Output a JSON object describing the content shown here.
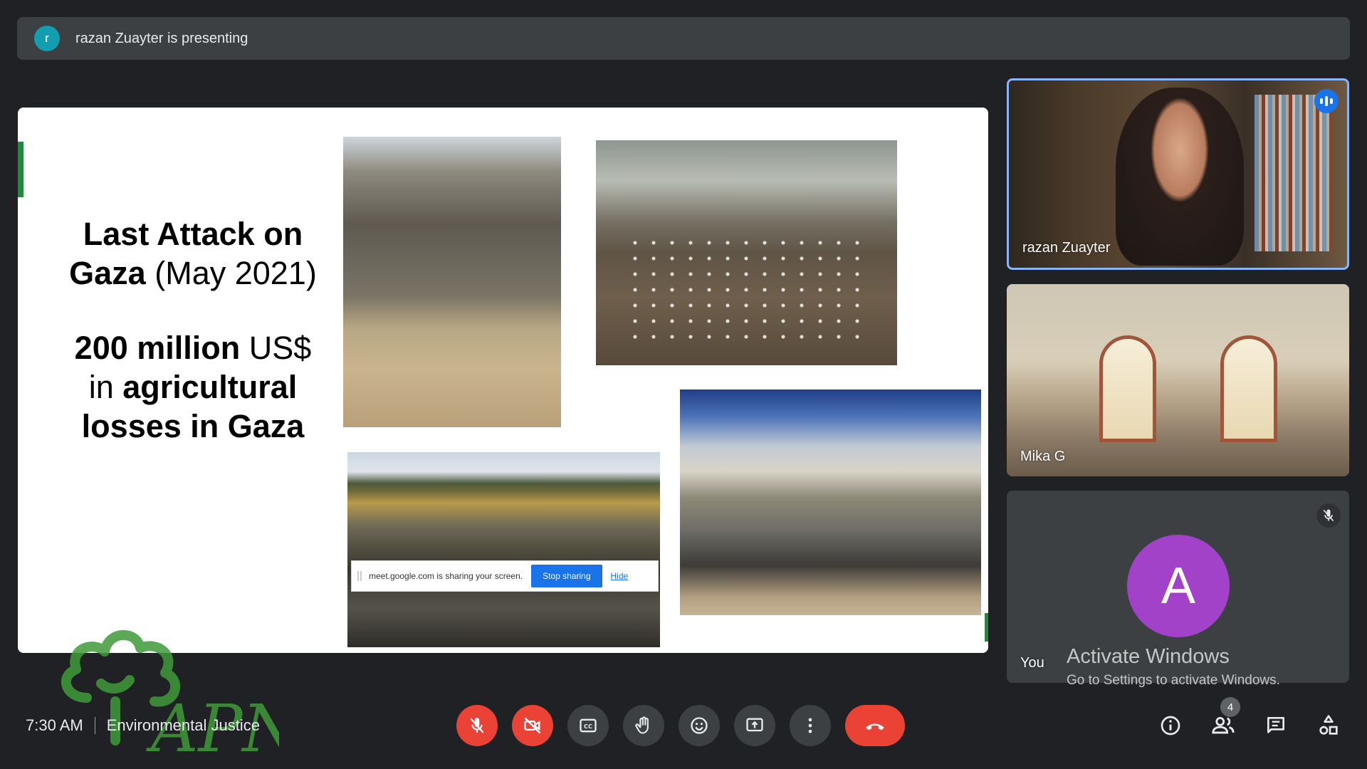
{
  "presenting_bar": {
    "avatar_letter": "r",
    "text": "razan Zuayter is presenting"
  },
  "slide": {
    "title_bold_1": "Last Attack on",
    "title_bold_2": "Gaza",
    "title_regular_2": " (May 2021)",
    "line3_bold": "200 million",
    "line3_regular": " US$",
    "line4_regular": "in ",
    "line4_bold": "agricultural",
    "line5_bold": "losses in Gaza"
  },
  "share_banner": {
    "text": "meet.google.com is sharing your screen.",
    "stop_label": "Stop sharing",
    "hide_label": "Hide"
  },
  "tiles": [
    {
      "name": "razan Zuayter",
      "speaking": true
    },
    {
      "name": "Mika G"
    },
    {
      "name": "You",
      "avatar_letter": "A",
      "muted": true
    }
  ],
  "watermark": {
    "activate_title": "Activate Windows",
    "activate_sub": "Go to Settings to activate Windows."
  },
  "meeting": {
    "time": "7:30 AM",
    "title": "Environmental Justice"
  },
  "people_count": "4",
  "colors": {
    "accent": "#1a73e8",
    "danger": "#ea4335",
    "avatar": "#a142c8",
    "bg": "#202124",
    "logo_green": "#2e8b3a"
  },
  "logo_text": "APN"
}
